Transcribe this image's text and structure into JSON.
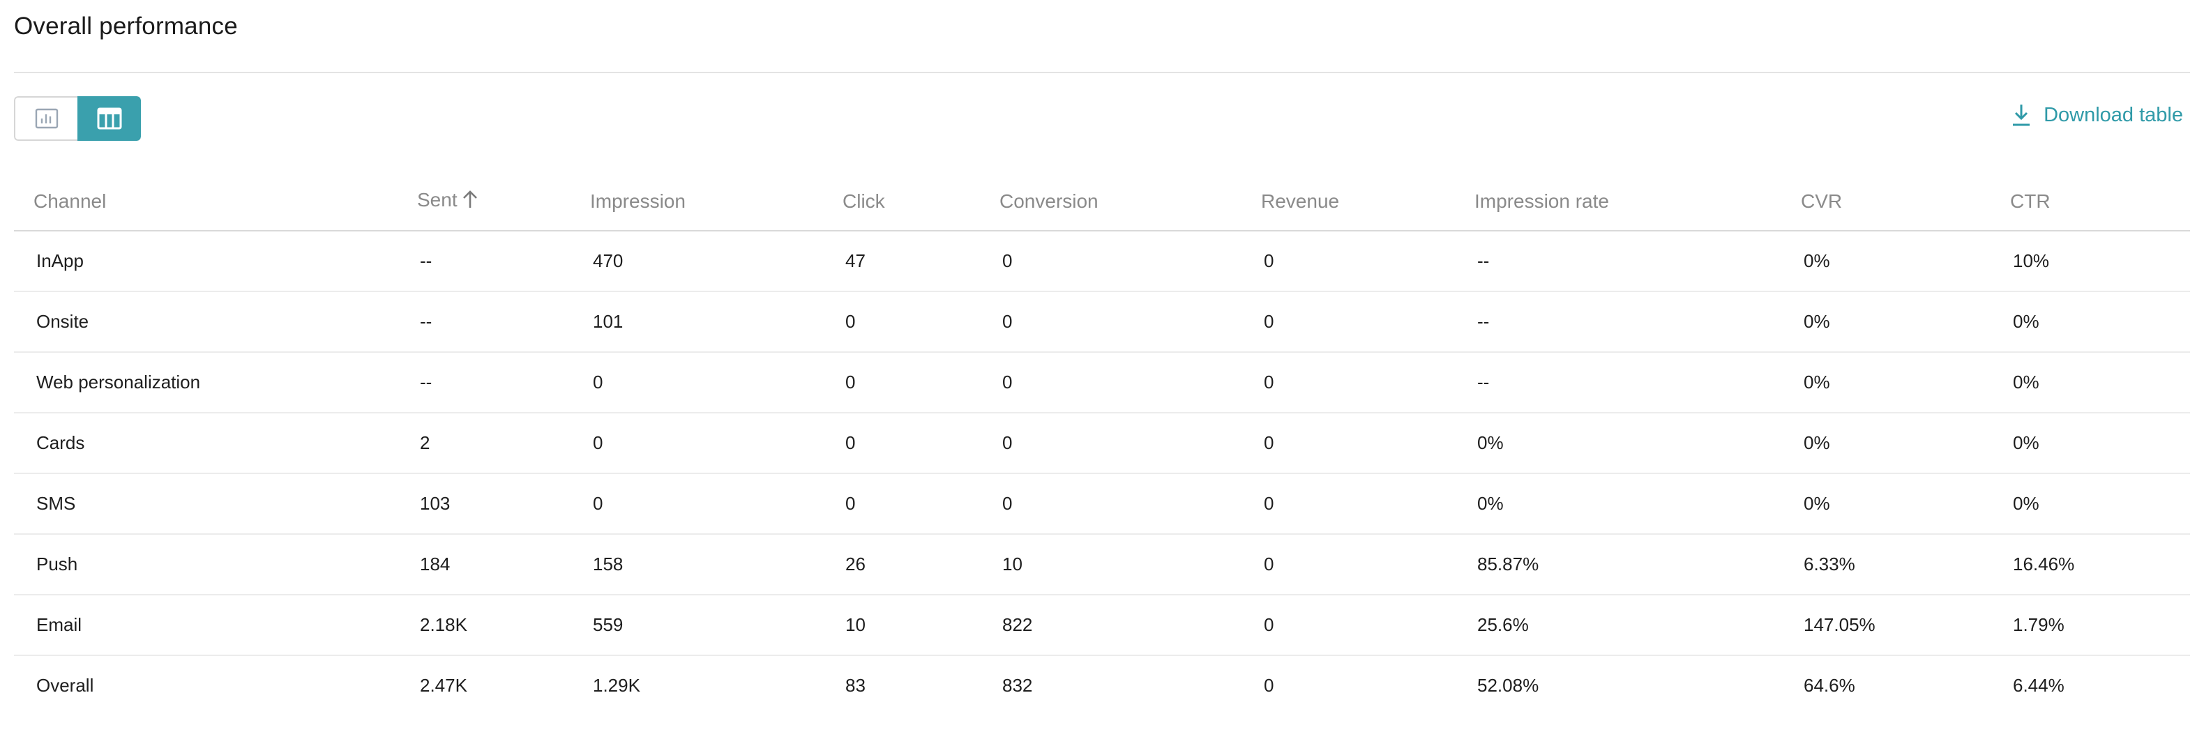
{
  "header": {
    "title": "Overall performance"
  },
  "toolbar": {
    "chart_view_icon": "bar-chart-icon",
    "table_view_icon": "table-icon",
    "download_label": "Download table",
    "download_icon": "download-icon",
    "accent_color": "#3aa0ad"
  },
  "table": {
    "columns": [
      "Channel",
      "Sent",
      "Impression",
      "Click",
      "Conversion",
      "Revenue",
      "Impression rate",
      "CVR",
      "CTR"
    ],
    "sort": {
      "column": "Sent",
      "direction": "ascending",
      "icon": "arrow-up-icon"
    },
    "rows": [
      [
        "InApp",
        "--",
        "470",
        "47",
        "0",
        "0",
        "--",
        "0%",
        "10%"
      ],
      [
        "Onsite",
        "--",
        "101",
        "0",
        "0",
        "0",
        "--",
        "0%",
        "0%"
      ],
      [
        "Web personalization",
        "--",
        "0",
        "0",
        "0",
        "0",
        "--",
        "0%",
        "0%"
      ],
      [
        "Cards",
        "2",
        "0",
        "0",
        "0",
        "0",
        "0%",
        "0%",
        "0%"
      ],
      [
        "SMS",
        "103",
        "0",
        "0",
        "0",
        "0",
        "0%",
        "0%",
        "0%"
      ],
      [
        "Push",
        "184",
        "158",
        "26",
        "10",
        "0",
        "85.87%",
        "6.33%",
        "16.46%"
      ],
      [
        "Email",
        "2.18K",
        "559",
        "10",
        "822",
        "0",
        "25.6%",
        "147.05%",
        "1.79%"
      ],
      [
        "Overall",
        "2.47K",
        "1.29K",
        "83",
        "832",
        "0",
        "52.08%",
        "64.6%",
        "6.44%"
      ]
    ]
  }
}
